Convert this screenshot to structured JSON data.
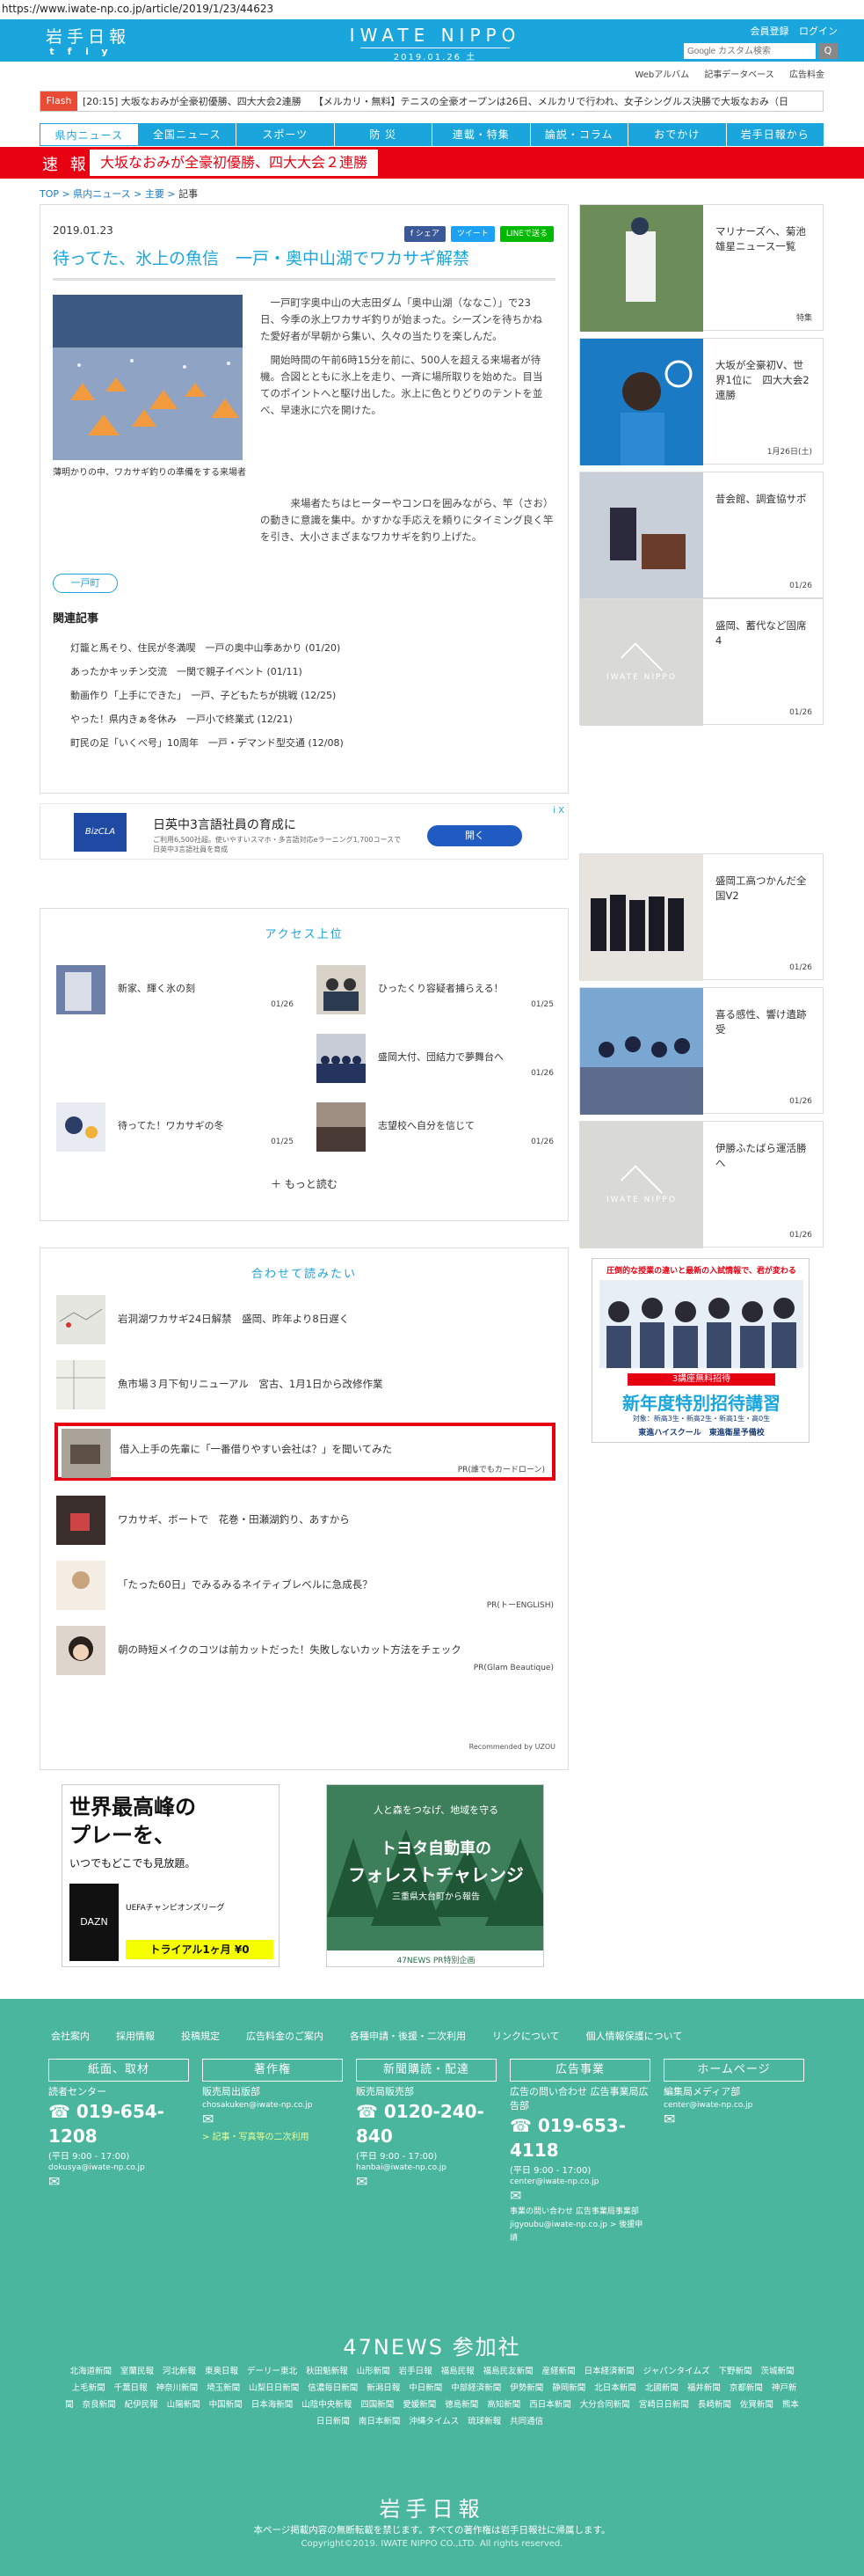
{
  "url": "https://www.iwate-np.co.jp/article/2019/1/23/44623",
  "header": {
    "logo": "岩手日報",
    "brand": "IWATE NIPPO",
    "date": "2019.01.26 土",
    "register": "会員登録",
    "login": "ログイン",
    "search_placeholder": "Google カスタム検索",
    "search_btn": "Q",
    "social": [
      "t",
      "f",
      "i",
      "y"
    ]
  },
  "subnav": [
    "Webアルバム",
    "記事データベース",
    "広告料金"
  ],
  "flash": {
    "label": "Flash",
    "items": [
      "[20:15] 大坂なおみが全豪初優勝、四大大会2連勝",
      "【メルカリ・無料】テニスの全豪オープンは26日、メルカリで行われ、女子シングルス決勝で大坂なおみ（日"
    ]
  },
  "gnav": [
    "県内ニュース",
    "全国ニュース",
    "スポーツ",
    "防 災",
    "連載・特集",
    "論説・コラム",
    "おでかけ",
    "岩手日報から"
  ],
  "breaking": {
    "label": "速 報",
    "text": "大坂なおみが全豪初優勝、四大大会２連勝"
  },
  "breadcrumb": [
    "TOP",
    "県内ニュース",
    "主要",
    "記事"
  ],
  "article": {
    "date": "2019.01.23",
    "share": [
      "f シェア",
      "ツイート",
      "LINEで送る"
    ],
    "title": "待ってた、氷上の魚信　一戸・奥中山湖でワカサギ解禁",
    "caption": "薄明かりの中、ワカサギ釣りの準備をする来場者",
    "p1": "一戸町字奥中山の大志田ダム「奥中山湖（ななこ）」で23日、今季の氷上ワカサギ釣りが始まった。シーズンを待ちかねた愛好者が早朝から集い、久々の当たりを楽しんだ。",
    "p2": "開始時間の午前6時15分を前に、500人を超える来場者が待機。合図とともに氷上を走り、一斉に場所取りを始めた。目当てのポイントへと駆け出した。氷上に色とりどりのテントを並べ、早速氷に穴を開けた。",
    "p3": "来場者たちはヒーターやコンロを囲みながら、竿（さお）の動きに意識を集中。かすかな手応えを頼りにタイミング良く竿を引き、大小さまざまなワカサギを釣り上げた。",
    "tag": "一戸町",
    "related_title": "関連記事",
    "related": [
      "灯籠と馬そり、住民が冬満喫　一戸の奥中山季あかり (01/20)",
      "あったかキッチン交流　一関で親子イベント (01/11)",
      "動画作り「上手にできた」　一戸、子どもたちが挑戦 (12/25)",
      "やった！県内きぁ冬休み　一戸小で終業式 (12/21)",
      "町民の足「いくべ号」10周年　一戸・デマンド型交通 (12/08)"
    ]
  },
  "ad": {
    "brand": "BizCLA",
    "title": "日英中3言語社員の育成に",
    "text": "ご利用6,500社超。使いやすいスマホ・多言語対応eラーニング1,700コースで日英中3言語社員を育成",
    "button": "開く",
    "close": "i X"
  },
  "access": {
    "title": "アクセス上位",
    "items": [
      {
        "t": "新家、輝く氷の刻",
        "d": "01/26"
      },
      {
        "t": "ひったくり容疑者捕らえる！",
        "d": "01/25"
      },
      {
        "t": "盛岡大付、団結力で夢舞台へ",
        "d": "01/26"
      },
      {
        "t": "待ってた！ワカサギの冬",
        "d": "01/25"
      },
      {
        "t": "志望校へ自分を信じて",
        "d": "01/26"
      }
    ],
    "more": "もっと読む"
  },
  "recommend": {
    "title": "合わせて読みたい",
    "items": [
      {
        "t": "岩洞湖ワカサギ24日解禁　盛岡、昨年より8日遅く",
        "p": ""
      },
      {
        "t": "魚市場３月下旬リニューアル　宮古、1月1日から改修作業",
        "p": ""
      },
      {
        "t": "借入上手の先輩に「一番借りやすい会社は？」を聞いてみた",
        "p": "PR(誰でもカードローン)"
      },
      {
        "t": "ワカサギ、ボートで　花巻・田瀬湖釣り、あすから",
        "p": ""
      },
      {
        "t": "「たった60日」でみるみるネイティブレベルに急成長？",
        "p": "PR(トーENGLISH)"
      },
      {
        "t": "朝の時短メイクのコツは前カットだった！失敗しないカット方法をチェック",
        "p": "PR(Glam Beautique)"
      }
    ],
    "powered": "Recommended by UZOU"
  },
  "banners": [
    {
      "a": "世界最高峰の",
      "b": "プレーを、",
      "c": "いつでもどこでも見放題。",
      "d": "UEFAチャンピオンズリーグ",
      "e": "トライアル1ヶ月 ¥0",
      "brand": "DAZN"
    },
    {
      "a": "人と森をつなげ、地域を守る",
      "b": "トヨタ自動車の",
      "c": "フォレストチャレンジ",
      "d": "三重県大台町から報告",
      "e": "47NEWS PR特別企画"
    }
  ],
  "side": [
    {
      "t": "マリナーズへ、菊池雄星ニュース一覧",
      "d": "特集"
    },
    {
      "t": "大坂が全豪初V、世界1位に　四大大会2連勝",
      "d": "1月26日(土)"
    },
    {
      "t": "昔会館、調査協サポ",
      "d": "01/26"
    },
    {
      "t": "盛岡、蓄代など固席4",
      "d": "01/26"
    },
    {
      "t": "盛岡工高つかんだ全国V2",
      "d": "01/26"
    },
    {
      "t": "喜る感性、響け遺跡受",
      "d": "01/26"
    },
    {
      "t": "伊勝ふたばら運活勝へ",
      "d": "01/26"
    }
  ],
  "sidead": {
    "top": "圧倒的な授業の違いと最新の入試情報で、君が変わる",
    "a": "3講座無料招待",
    "b": "新年度特別招待講習",
    "c": "対象：新高3生・新高2生・新高1生・高0生",
    "d": "東進ハイスクール　東進衛星予備校"
  },
  "footer": {
    "top": [
      "会社案内",
      "採用情報",
      "投稿規定",
      "広告料金のご案内",
      "各種申請・後援・二次利用",
      "リンクについて",
      "個人情報保護について"
    ],
    "cols": [
      {
        "h": "紙面、取材",
        "n": "読者センター",
        "p": "019-654-1208",
        "hr": "(平日 9:00 - 17:00)",
        "m": "dokusya@iwate-np.co.jp",
        "l": ""
      },
      {
        "h": "著作権",
        "n": "販売局出版部",
        "p": "",
        "hr": "",
        "m": "chosakuken@iwate-np.co.jp",
        "l": "> 記事・写真等の二次利用"
      },
      {
        "h": "新聞購読・配達",
        "n": "販売局販売部",
        "p": "0120-240-840",
        "hr": "(平日 9:00 - 17:00)",
        "m": "hanbai@iwate-np.co.jp",
        "l": ""
      },
      {
        "h": "広告事業",
        "n": "広告の問い合わせ 広告事業局広告部",
        "p": "019-653-4118",
        "hr": "(平日 9:00 - 17:00)",
        "m": "center@iwate-np.co.jp",
        "l": "事業の問い合わせ 広告事業局事業部 jigyoubu@iwate-np.co.jp > 後援申請"
      },
      {
        "h": "ホームページ",
        "n": "編集局メディア部",
        "p": "",
        "hr": "",
        "m": "center@iwate-np.co.jp",
        "l": ""
      }
    ],
    "n47": "47NEWS 参加社",
    "papers": [
      "北海道新聞",
      "室蘭民報",
      "河北新報",
      "東奥日報",
      "デーリー東北",
      "秋田魁新報",
      "山形新聞",
      "岩手日報",
      "福島民報",
      "福島民友新聞",
      "産経新聞",
      "日本経済新聞",
      "ジャパンタイムズ",
      "下野新聞",
      "茨城新聞",
      "上毛新聞",
      "千葉日報",
      "神奈川新聞",
      "埼玉新聞",
      "山梨日日新聞",
      "信濃毎日新聞",
      "新潟日報",
      "中日新聞",
      "中部経済新聞",
      "伊勢新聞",
      "静岡新聞",
      "北日本新聞",
      "北國新聞",
      "福井新聞",
      "京都新聞",
      "神戸新聞",
      "奈良新聞",
      "紀伊民報",
      "山陽新聞",
      "中国新聞",
      "日本海新聞",
      "山陰中央新報",
      "四国新聞",
      "愛媛新聞",
      "徳島新聞",
      "高知新聞",
      "西日本新聞",
      "大分合同新聞",
      "宮崎日日新聞",
      "長崎新聞",
      "佐賀新聞",
      "熊本日日新聞",
      "南日本新聞",
      "沖縄タイムス",
      "琉球新報",
      "共同通信"
    ],
    "logo": "岩手日報",
    "note": "本ページ掲載内容の無断転載を禁じます。すべての著作権は岩手日報社に帰属します。",
    "copy": "Copyright©2019. IWATE NIPPO CO.,LTD. All rights reserved."
  }
}
